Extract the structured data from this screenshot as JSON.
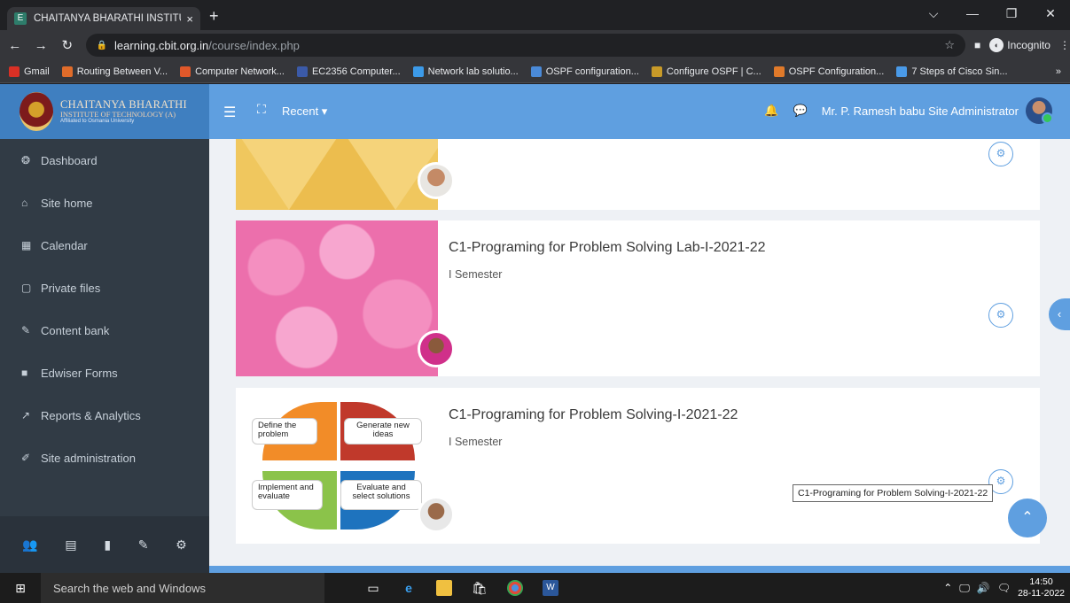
{
  "browser": {
    "tab_title": "CHAITANYA BHARATHI INSTITUTI",
    "tab_close": "×",
    "new_tab": "+",
    "url_host": "learning.cbit.org.in",
    "url_path": "/course/index.php",
    "incognito_label": "Incognito",
    "bookmarks": [
      {
        "label": "Gmail",
        "color": "#d93025"
      },
      {
        "label": "Routing Between V...",
        "color": "#e06c2a"
      },
      {
        "label": "Computer Network...",
        "color": "#e0582a"
      },
      {
        "label": "EC2356 Computer...",
        "color": "#3b5aa8"
      },
      {
        "label": "Network lab solutio...",
        "color": "#3c9ae8"
      },
      {
        "label": "OSPF configuration...",
        "color": "#4a8ad8"
      },
      {
        "label": "Configure OSPF | C...",
        "color": "#c89a28"
      },
      {
        "label": "OSPF Configuration...",
        "color": "#e07a2a"
      },
      {
        "label": "7 Steps of Cisco Sin...",
        "color": "#4a9ae8"
      }
    ],
    "bookmarks_more": "»"
  },
  "header": {
    "brand_line1": "CHAITANYA BHARATHI",
    "brand_line2": "INSTITUTE OF TECHNOLOGY (A)",
    "brand_line3": "Affiliated to Osmania University",
    "recent_label": "Recent ▾",
    "user_name": "Mr. P. Ramesh babu Site Administrator"
  },
  "sidebar": {
    "items": [
      {
        "label": "Dashboard",
        "icon": "dashboard-icon",
        "glyph": "❂"
      },
      {
        "label": "Site home",
        "icon": "home-icon",
        "glyph": "⌂"
      },
      {
        "label": "Calendar",
        "icon": "calendar-icon",
        "glyph": "▦"
      },
      {
        "label": "Private files",
        "icon": "file-icon",
        "glyph": "▢"
      },
      {
        "label": "Content bank",
        "icon": "brush-icon",
        "glyph": "✎"
      },
      {
        "label": "Edwiser Forms",
        "icon": "form-icon",
        "glyph": "■"
      },
      {
        "label": "Reports & Analytics",
        "icon": "chart-icon",
        "glyph": "↗"
      },
      {
        "label": "Site administration",
        "icon": "wrench-icon",
        "glyph": "✐"
      }
    ]
  },
  "courses": [
    {
      "title": "",
      "subtitle": ""
    },
    {
      "title": "C1-Programing for Problem Solving Lab-I-2021-22",
      "subtitle": "I Semester"
    },
    {
      "title": "C1-Programing for Problem Solving-I-2021-22",
      "subtitle": "I Semester",
      "quad": {
        "q1": "Define the problem",
        "q2": "Generate new ideas",
        "q3": "Implement and evaluate",
        "q4": "Evaluate and select solutions"
      }
    }
  ],
  "tooltip": "C1-Programing for Problem Solving-I-2021-22",
  "taskbar": {
    "search_placeholder": "Search the web and Windows",
    "time": "14:50",
    "date": "28-11-2022"
  }
}
